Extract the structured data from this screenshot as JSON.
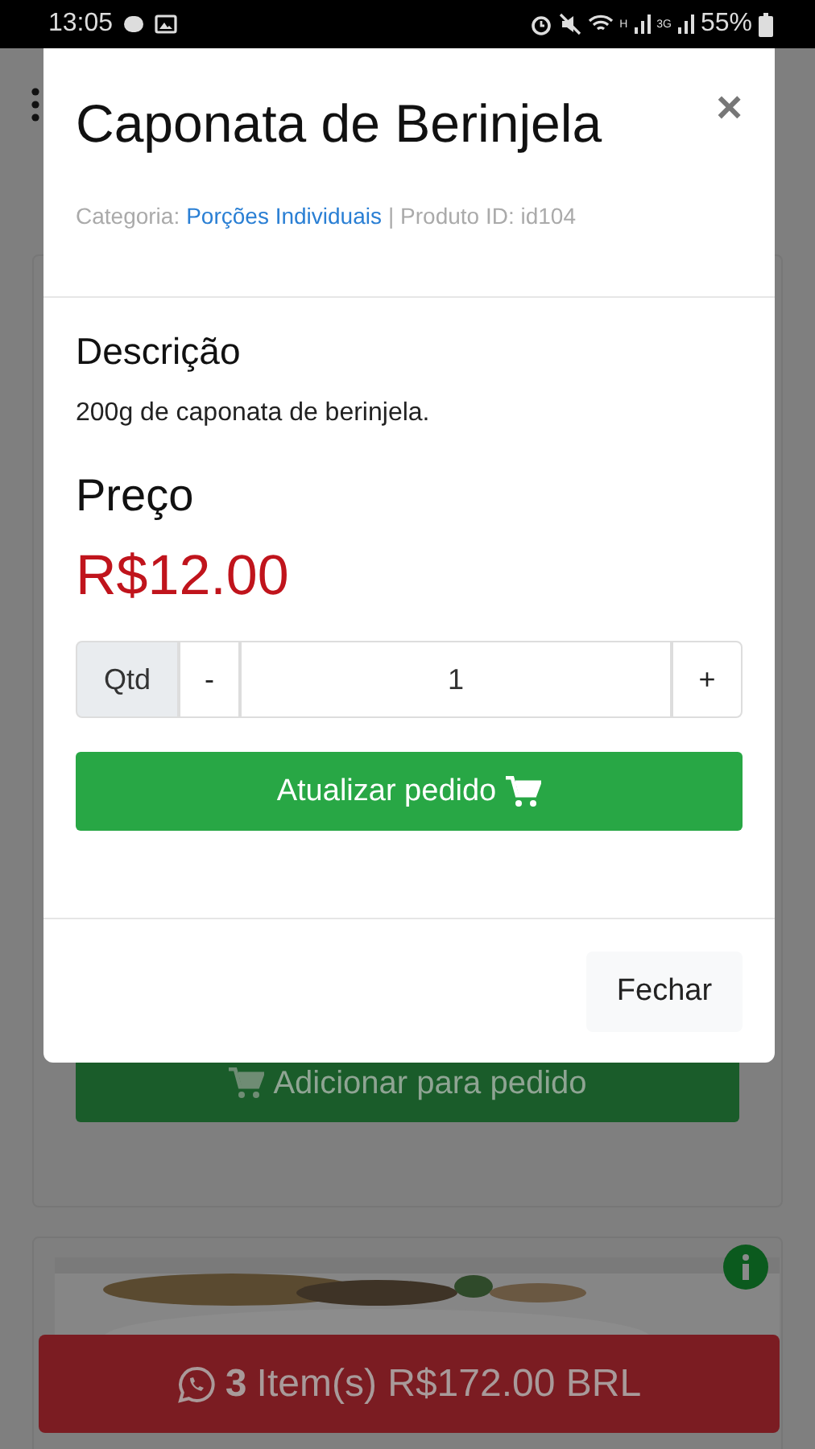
{
  "status_bar": {
    "time": "13:05",
    "network_1": "H",
    "network_2": "3G",
    "battery": "55%"
  },
  "background": {
    "add_button": "Adicionar para pedido",
    "cart_bar": {
      "count": "3",
      "text": "Item(s) R$172.00 BRL"
    }
  },
  "modal": {
    "title": "Caponata de Berinjela",
    "close_icon": "×",
    "category_label": "Categoria:",
    "category_link": "Porções Individuais",
    "product_id": "| Produto ID: id104",
    "description_heading": "Descrição",
    "description": "200g de caponata de berinjela.",
    "price_heading": "Preço",
    "price": "R$12.00",
    "quantity": {
      "label": "Qtd",
      "minus": "-",
      "value": "1",
      "plus": "+"
    },
    "update_button": "Atualizar pedido",
    "close_button": "Fechar"
  }
}
